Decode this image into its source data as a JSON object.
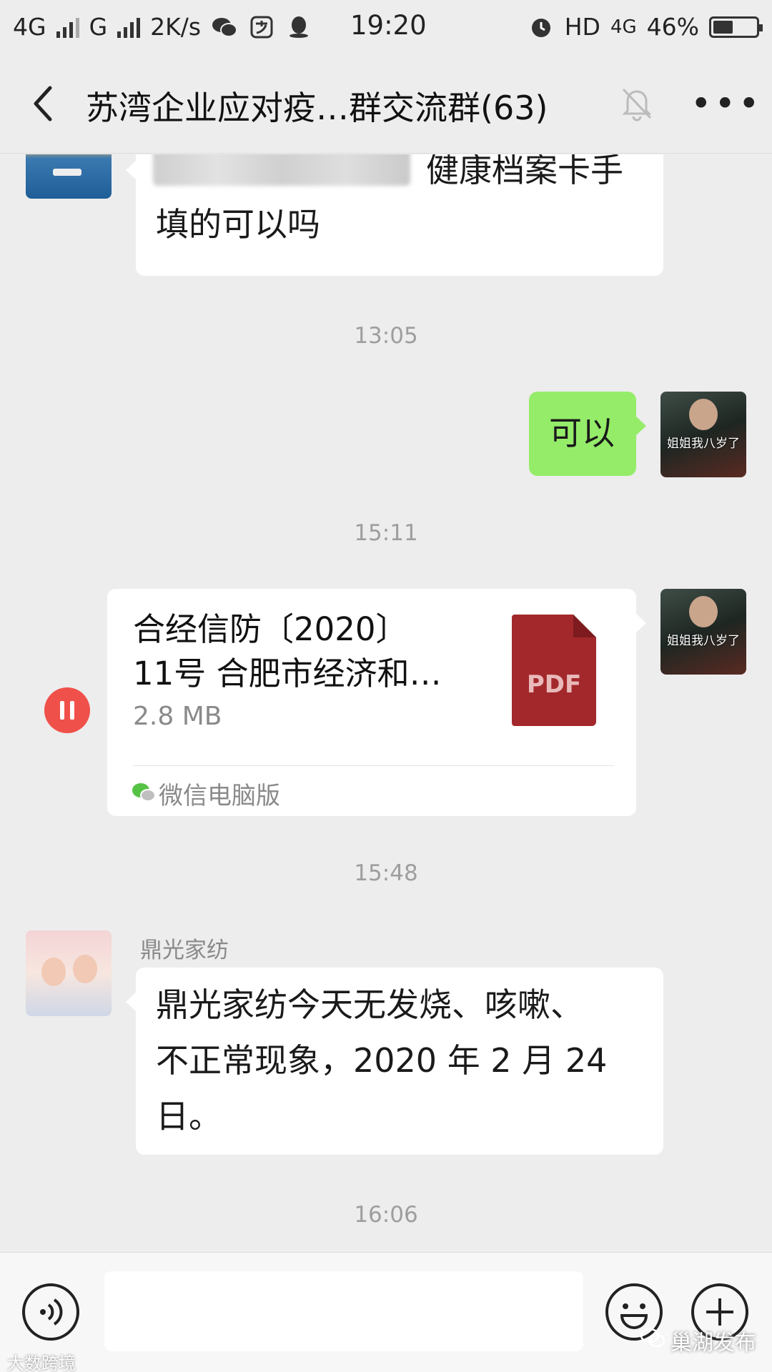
{
  "status_bar": {
    "network1": "4G",
    "network2": "G",
    "speed": "2K/s",
    "time": "19:20",
    "hd": "HD",
    "network3": "4G",
    "battery": "46%",
    "battery_level": 0.46
  },
  "header": {
    "title": "苏湾企业应对疫…群交流群(63)"
  },
  "messages": {
    "m1": {
      "line1": "健康档案卡手",
      "line2": "填的可以吗"
    },
    "t1": "13:05",
    "m2": {
      "text": "可以",
      "sticker_text": "姐姐我八岁了"
    },
    "t2": "15:11",
    "m3": {
      "file_title_line1": "合经信防〔2020〕",
      "file_title_line2": "11号 合肥市经济和…",
      "file_size": "2.8 MB",
      "file_type": "PDF",
      "source": "微信电脑版",
      "sticker_text": "姐姐我八岁了"
    },
    "t3": "15:48",
    "m4": {
      "sender": "鼎光家纺",
      "line1": "鼎光家纺今天无发烧、咳嗽、",
      "line2": "不正常现象，2020 年 2 月 24",
      "line3": "日。"
    },
    "t4": "16:06"
  },
  "input": {
    "placeholder": ""
  },
  "watermarks": {
    "left": "大数跨境",
    "right": "巢湖发布"
  },
  "colors": {
    "background": "#ededed",
    "sent_bubble": "#95ec69",
    "pdf_red": "#a3282b",
    "pause_red": "#f0504a"
  }
}
